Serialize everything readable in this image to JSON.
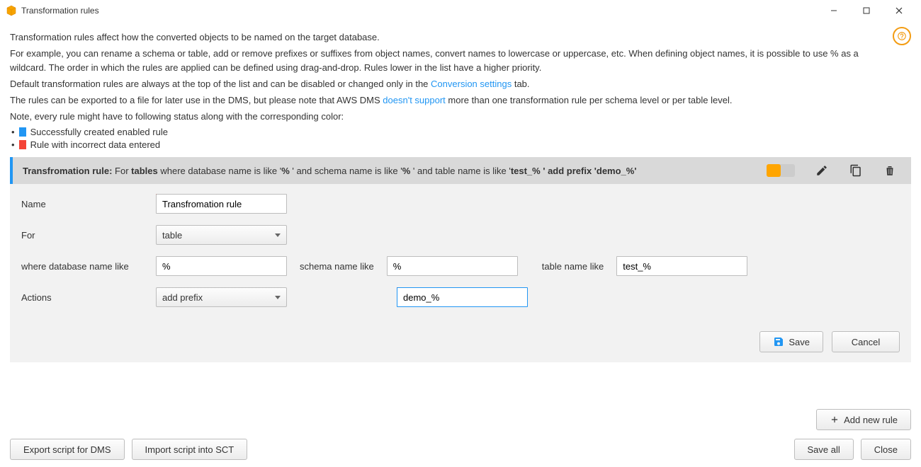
{
  "window": {
    "title": "Transformation rules",
    "minimize": "—",
    "maximize": "□",
    "close": "✕"
  },
  "help": "?",
  "intro": {
    "p1": "Transformation rules affect how the converted objects to be named on the target database.",
    "p2a": "For example, you can rename a schema or table, add or remove prefixes or suffixes from object names, convert names to lowercase or uppercase, etc. When defining object names, it is possible to use % as a wildcard. The order in which the rules are applied can be defined using drag-and-drop. Rules lower in the list have a higher priority.",
    "p3a": "Default transformation rules are always at the top of the list and can be disabled or changed only in the ",
    "p3_link": "Conversion settings",
    "p3b": " tab.",
    "p4a": "The rules can be exported to a file for later use in the DMS, but please note that AWS DMS ",
    "p4_link": "doesn't support",
    "p4b": " more than one transformation rule per schema level or per table level.",
    "p5": "Note, every rule might have to following status along with the corresponding color:"
  },
  "bullets": {
    "b1": "Successfully created enabled rule",
    "b2": "Rule with incorrect data entered"
  },
  "rule": {
    "header": {
      "name_label": "Transfromation rule:",
      "for_prefix": " For ",
      "for_bold": "tables",
      "db_part": " where database name is like '",
      "db_val": "%",
      "schema_part": "' and schema name is like '",
      "schema_val": "%",
      "table_part": "' and table name is like '",
      "table_val": "test_%",
      "action_part": "' add prefix '",
      "action_val": "demo_%",
      "end": "'"
    },
    "labels": {
      "name": "Name",
      "for": "For",
      "db": "where database name like",
      "schema": "schema name like",
      "table": "table name like",
      "actions": "Actions"
    },
    "values": {
      "name": "Transfromation rule",
      "for": "table",
      "db": "%",
      "schema": "%",
      "table": "test_%",
      "action": "add prefix",
      "action_value": "demo_%"
    },
    "buttons": {
      "save": "Save",
      "cancel": "Cancel"
    }
  },
  "footer": {
    "add": "Add new rule",
    "export": "Export script for DMS",
    "import": "Import script into SCT",
    "save_all": "Save all",
    "close": "Close"
  }
}
